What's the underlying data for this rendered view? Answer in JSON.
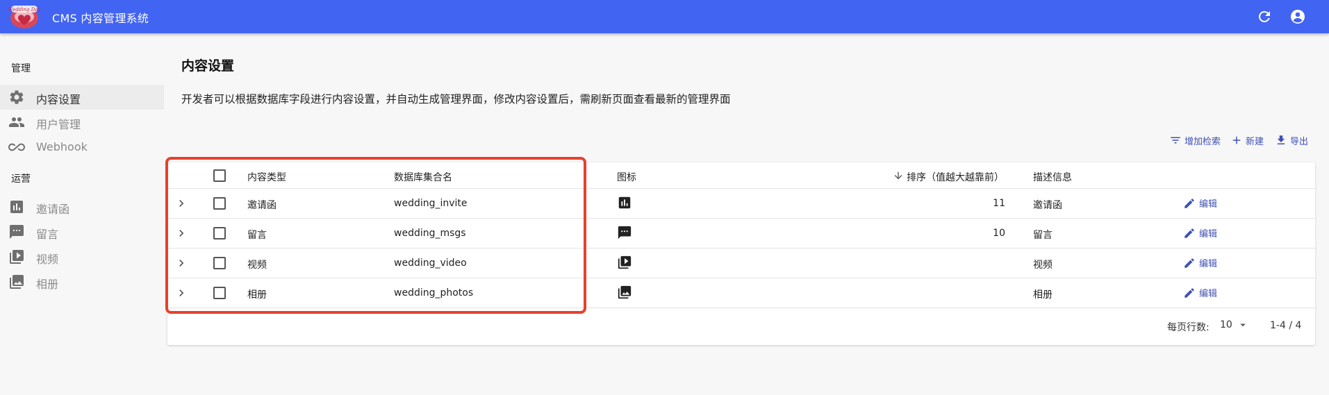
{
  "app": {
    "title": "CMS 内容管理系统",
    "logo_text": "Wedding Day",
    "refresh_icon": "refresh-icon",
    "account_icon": "account-circle-icon"
  },
  "sidebar": {
    "section_manage": "管理",
    "manage_items": [
      {
        "label": "内容设置",
        "icon": "gear-icon",
        "active": true
      },
      {
        "label": "用户管理",
        "icon": "people-icon"
      },
      {
        "label": "Webhook",
        "icon": "infinity-icon"
      }
    ],
    "section_ops": "运营",
    "ops_items": [
      {
        "label": "邀请函",
        "icon": "bar-chart-icon"
      },
      {
        "label": "留言",
        "icon": "message-icon"
      },
      {
        "label": "视频",
        "icon": "video-library-icon"
      },
      {
        "label": "相册",
        "icon": "photo-library-icon"
      }
    ]
  },
  "main": {
    "title": "内容设置",
    "description": "开发者可以根据数据库字段进行内容设置，并自动生成管理界面，修改内容设置后，需刷新页面查看最新的管理界面",
    "toolbar": {
      "filter_label": "增加检索",
      "create_label": "新建",
      "export_label": "导出"
    }
  },
  "table": {
    "columns": {
      "type": "内容类型",
      "collection": "数据库集合名",
      "icon": "图标",
      "order": "排序（值越大越靠前）",
      "desc": "描述信息"
    },
    "edit_label": "编辑",
    "rows": [
      {
        "type": "邀请函",
        "collection": "wedding_invite",
        "icon": "bar-chart-icon",
        "order": "11",
        "desc": "邀请函"
      },
      {
        "type": "留言",
        "collection": "wedding_msgs",
        "icon": "message-icon",
        "order": "10",
        "desc": "留言"
      },
      {
        "type": "视频",
        "collection": "wedding_video",
        "icon": "video-library-icon",
        "order": "",
        "desc": "视频"
      },
      {
        "type": "相册",
        "collection": "wedding_photos",
        "icon": "photo-library-icon",
        "order": "",
        "desc": "相册"
      }
    ]
  },
  "pagination": {
    "rows_per_page_label": "每页行数:",
    "rows_per_page": "10",
    "range": "1-4 / 4"
  },
  "colors": {
    "appbar": "#4264f2",
    "accent": "#3f51b5",
    "highlight": "#e8412c"
  }
}
